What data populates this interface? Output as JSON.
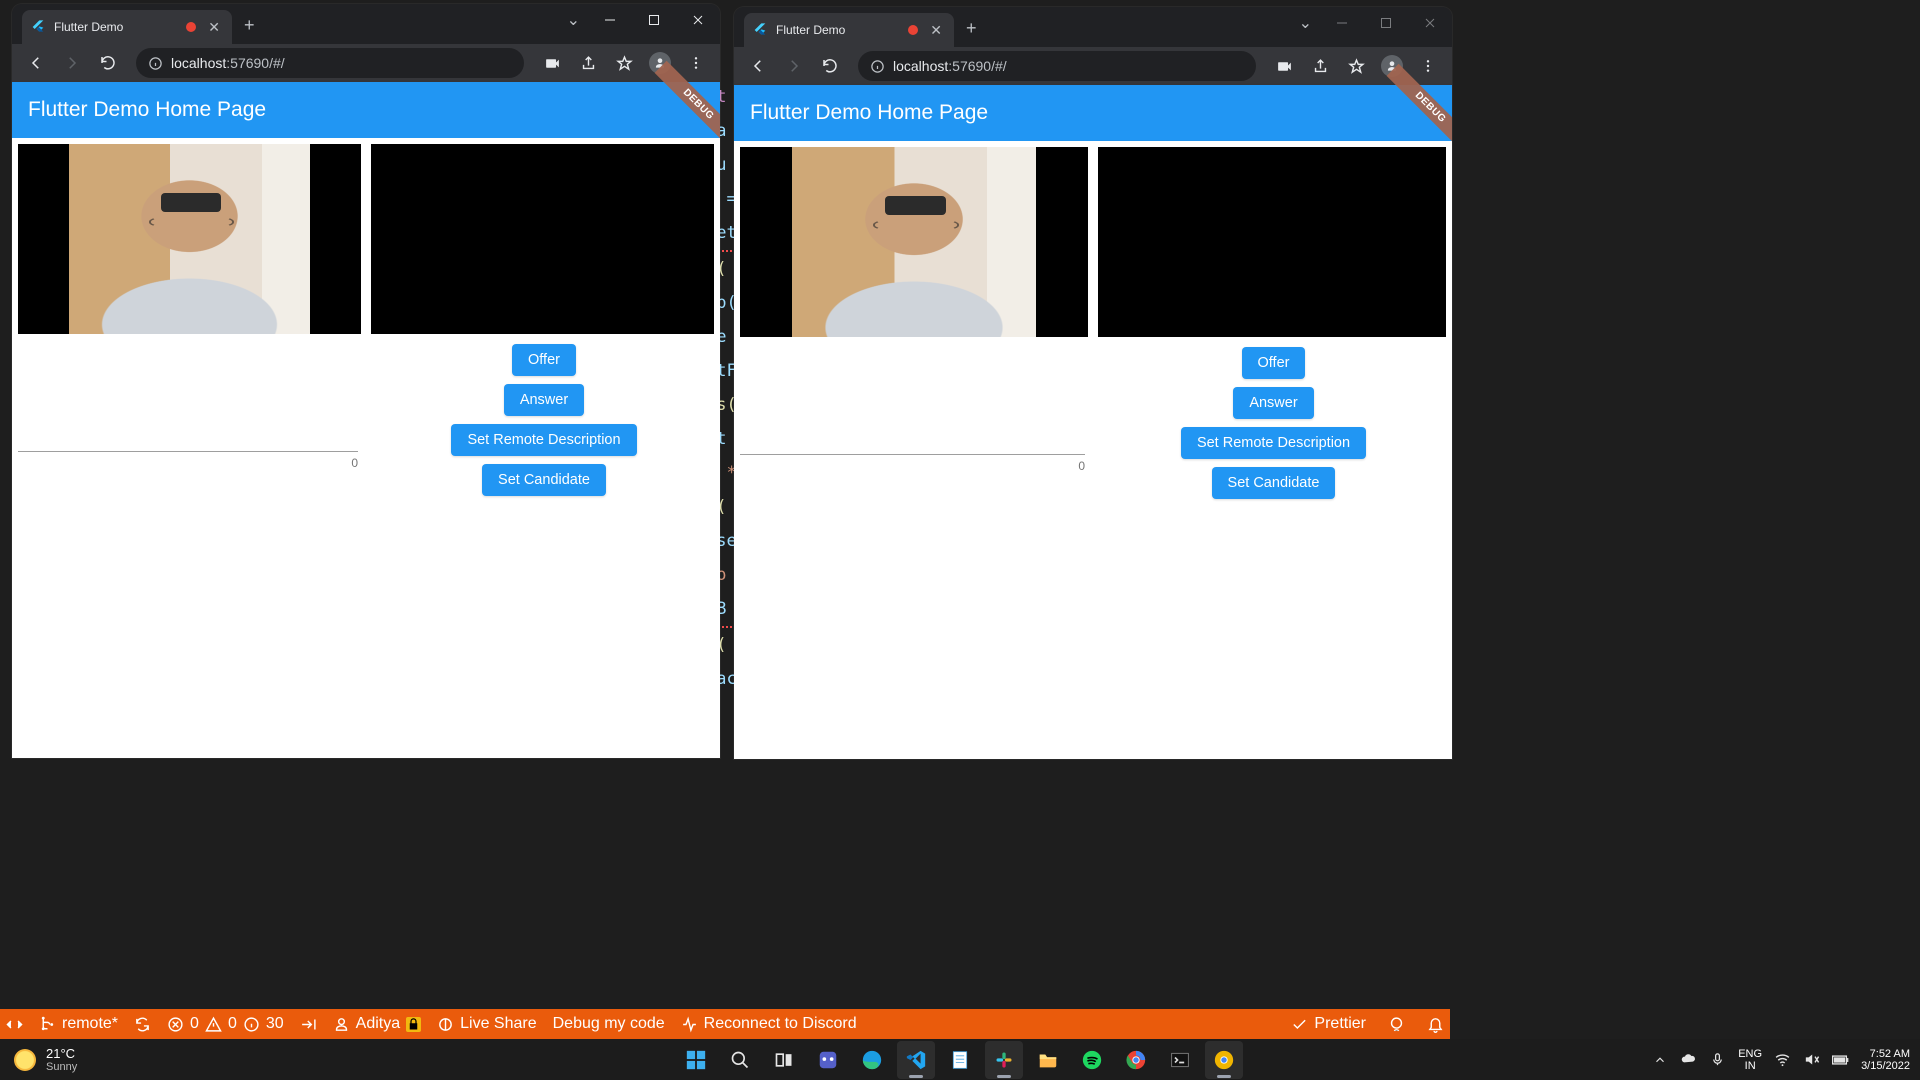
{
  "windows": [
    {
      "tab_title": "Flutter Demo",
      "has_recording": true,
      "url_host": "localhost",
      "url_port": ":57690",
      "url_path": "/#/",
      "app_title": "Flutter Demo Home Page",
      "debug_label": "DEBUG",
      "input_value": "",
      "counter": "0",
      "buttons": {
        "offer": "Offer",
        "answer": "Answer",
        "set_remote": "Set Remote Description",
        "set_candidate": "Set Candidate"
      }
    },
    {
      "tab_title": "Flutter Demo",
      "has_recording": true,
      "url_host": "localhost",
      "url_port": ":57690",
      "url_path": "/#/",
      "app_title": "Flutter Demo Home Page",
      "debug_label": "DEBUG",
      "input_value": "",
      "counter": "0",
      "buttons": {
        "offer": "Offer",
        "answer": "Answer",
        "set_remote": "Set Remote Description",
        "set_candidate": "Set Candidate"
      }
    }
  ],
  "code_snips": [
    "rt",
    "Pa",
    "Cu",
    "",
    ") =",
    "set",
    "d(",
    "dp(",
    "Te",
    "",
    "xtF",
    "",
    "ns(",
    "nt ",
    "\" * \"",
    "",
    "n(",
    "_se",
    "\"o",
    "dB",
    "n(",
    "_ac",
    "}"
  ],
  "statusbar": {
    "branch": "remote*",
    "errors": "0",
    "warnings": "0",
    "info": "30",
    "user": "Aditya",
    "live_share": "Live Share",
    "debug": "Debug my code",
    "reconnect": "Reconnect to Discord",
    "prettier": "Prettier"
  },
  "taskbar": {
    "temp": "21°C",
    "cond": "Sunny",
    "lang_top": "ENG",
    "lang_bot": "IN",
    "time": "7:52 AM",
    "date": "3/15/2022"
  }
}
